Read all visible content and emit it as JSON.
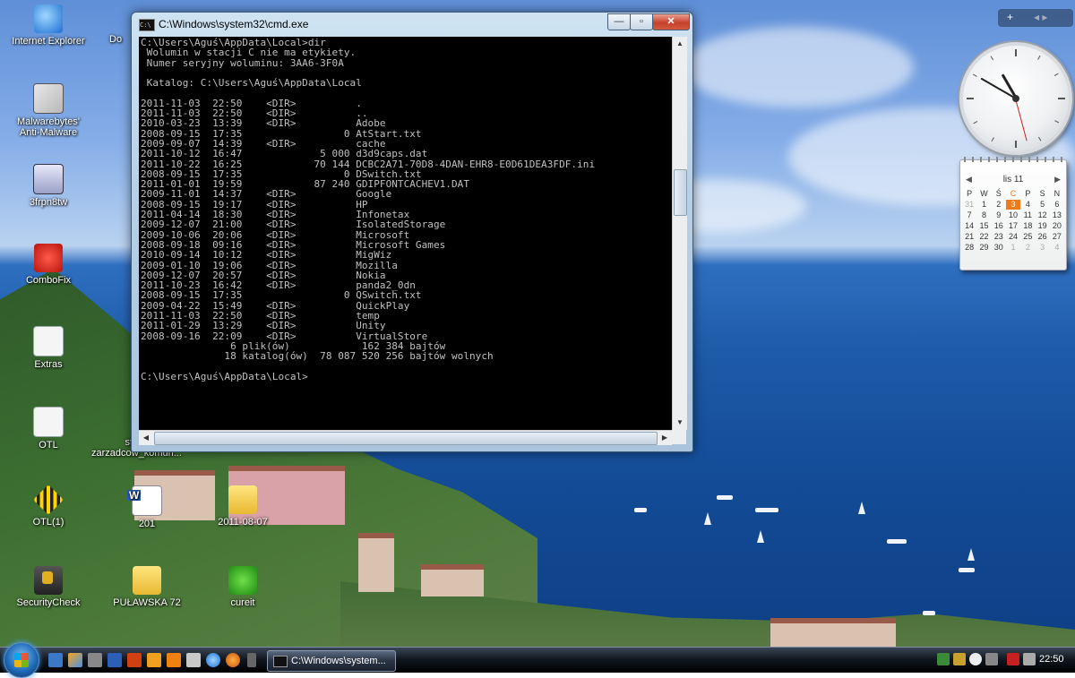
{
  "desktop": {
    "icons": [
      {
        "label": "Internet Explorer"
      },
      {
        "label": "Malwarebytes' Anti-Malware"
      },
      {
        "label": "3frpn8tw"
      },
      {
        "label": "ComboFix"
      },
      {
        "label": "Extras"
      },
      {
        "label": "OTL"
      },
      {
        "label": "OTL(1)"
      },
      {
        "label": "SecurityCheck"
      },
      {
        "label": "201"
      },
      {
        "label": "2011-08-07"
      },
      {
        "label": "PUŁAWSKA 72"
      },
      {
        "label": "cureit"
      },
      {
        "label": "Do"
      },
      {
        "label": "st"
      },
      {
        "label": "zarzadcow_komun..."
      }
    ]
  },
  "window": {
    "title": "C:\\Windows\\system32\\cmd.exe",
    "minimize": "—",
    "maximize": "▫",
    "close": "✕",
    "console_lines": [
      "C:\\Users\\Aguś\\AppData\\Local>dir",
      " Wolumin w stacji C nie ma etykiety.",
      " Numer seryjny woluminu: 3AA6-3F0A",
      "",
      " Katalog: C:\\Users\\Aguś\\AppData\\Local",
      "",
      "2011-11-03  22:50    <DIR>          .",
      "2011-11-03  22:50    <DIR>          ..",
      "2010-03-23  13:39    <DIR>          Adobe",
      "2008-09-15  17:35                 0 AtStart.txt",
      "2009-09-07  14:39    <DIR>          cache",
      "2011-10-12  16:47             5 000 d3d9caps.dat",
      "2011-10-22  16:25            70 144 DCBC2A71-70D8-4DAN-EHR8-E0D61DEA3FDF.ini",
      "2008-09-15  17:35                 0 DSwitch.txt",
      "2011-01-01  19:59            87 240 GDIPFONTCACHEV1.DAT",
      "2009-11-01  14:37    <DIR>          Google",
      "2008-09-15  19:17    <DIR>          HP",
      "2011-04-14  18:30    <DIR>          Infonetax",
      "2009-12-07  21:00    <DIR>          IsolatedStorage",
      "2009-10-06  20:06    <DIR>          Microsoft",
      "2008-09-18  09:16    <DIR>          Microsoft Games",
      "2010-09-14  10:12    <DIR>          MigWiz",
      "2009-01-10  19:06    <DIR>          Mozilla",
      "2009-12-07  20:57    <DIR>          Nokia",
      "2011-10-23  16:42    <DIR>          panda2_0dn",
      "2008-09-15  17:35                 0 QSwitch.txt",
      "2009-04-22  15:49    <DIR>          QuickPlay",
      "2011-11-03  22:50    <DIR>          temp",
      "2011-01-29  13:29    <DIR>          Unity",
      "2008-09-16  22:09    <DIR>          VirtualStore",
      "               6 plik(ów)            162 384 bajtów",
      "              18 katalog(ów)  78 087 520 256 bajtów wolnych",
      "",
      "C:\\Users\\Aguś\\AppData\\Local>"
    ]
  },
  "sidebar": {
    "add_label": "+",
    "nav_label": "◂ ▸",
    "calendar": {
      "month": "lis 11",
      "weekdays": [
        "P",
        "W",
        "Ś",
        "C",
        "P",
        "S",
        "N"
      ],
      "days": [
        {
          "d": "31",
          "dim": true
        },
        {
          "d": "1"
        },
        {
          "d": "2"
        },
        {
          "d": "3",
          "today": true
        },
        {
          "d": "4"
        },
        {
          "d": "5"
        },
        {
          "d": "6"
        },
        {
          "d": "7"
        },
        {
          "d": "8"
        },
        {
          "d": "9"
        },
        {
          "d": "10"
        },
        {
          "d": "11"
        },
        {
          "d": "12"
        },
        {
          "d": "13"
        },
        {
          "d": "14"
        },
        {
          "d": "15"
        },
        {
          "d": "16"
        },
        {
          "d": "17"
        },
        {
          "d": "18"
        },
        {
          "d": "19"
        },
        {
          "d": "20"
        },
        {
          "d": "21"
        },
        {
          "d": "22"
        },
        {
          "d": "23"
        },
        {
          "d": "24"
        },
        {
          "d": "25"
        },
        {
          "d": "26"
        },
        {
          "d": "27"
        },
        {
          "d": "28"
        },
        {
          "d": "29"
        },
        {
          "d": "30"
        },
        {
          "d": "1",
          "dim": true
        },
        {
          "d": "2",
          "dim": true
        },
        {
          "d": "3",
          "dim": true
        },
        {
          "d": "4",
          "dim": true
        }
      ]
    }
  },
  "taskbar": {
    "active_task": "C:\\Windows\\system...",
    "clock": "22:50"
  },
  "colors": {
    "console_bg": "#000000",
    "console_text": "#c0c0c0",
    "today_highlight": "#f07a1a"
  }
}
